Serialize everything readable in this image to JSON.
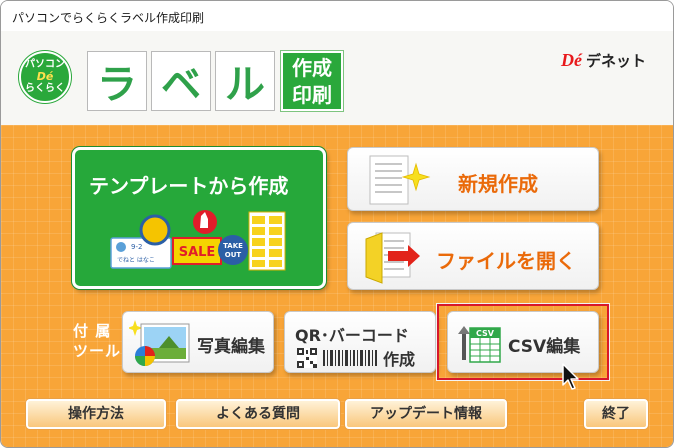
{
  "window": {
    "title": "パソコンでらくらくラベル作成印刷"
  },
  "header": {
    "badge": {
      "line1": "パソコン",
      "line2": "Dé",
      "line3": "らくらく"
    },
    "logo_letters": [
      "ラ",
      "ベ",
      "ル"
    ],
    "logo_sub": {
      "line1": "作成",
      "line2": "印刷"
    },
    "brand": {
      "mark": "Dé",
      "name": "デネット"
    }
  },
  "main": {
    "template_button": {
      "label": "テンプレートから作成",
      "art": {
        "card_line1": "9-2",
        "card_line2": "でねと はなこ",
        "sale": "SALE",
        "takeout_line1": "TAKE",
        "takeout_line2": "OUT"
      }
    },
    "new_button": {
      "label": "新規作成"
    },
    "open_button": {
      "label": "ファイルを開く"
    },
    "tools": {
      "label_line1": "付 属",
      "label_line2": "ツール",
      "photo_label": "写真編集",
      "qr_label_line1": "QR･バーコード",
      "qr_label_line2": "作成",
      "csv_icon_text": "CSV",
      "csv_label": "CSV編集"
    },
    "bottom": {
      "howto": "操作方法",
      "faq": "よくある質問",
      "update": "アップデート情報",
      "exit": "終了"
    }
  },
  "colors": {
    "accent_green": "#26a83a",
    "accent_orange": "#f8a538",
    "highlight": "#d8182a",
    "label_orange": "#ea6a0a"
  },
  "icons": [
    "sparkle-icon",
    "folder-arrow-icon",
    "photo-icon",
    "qr-code-icon",
    "barcode-icon",
    "csv-file-icon",
    "mouse-pointer-icon"
  ]
}
